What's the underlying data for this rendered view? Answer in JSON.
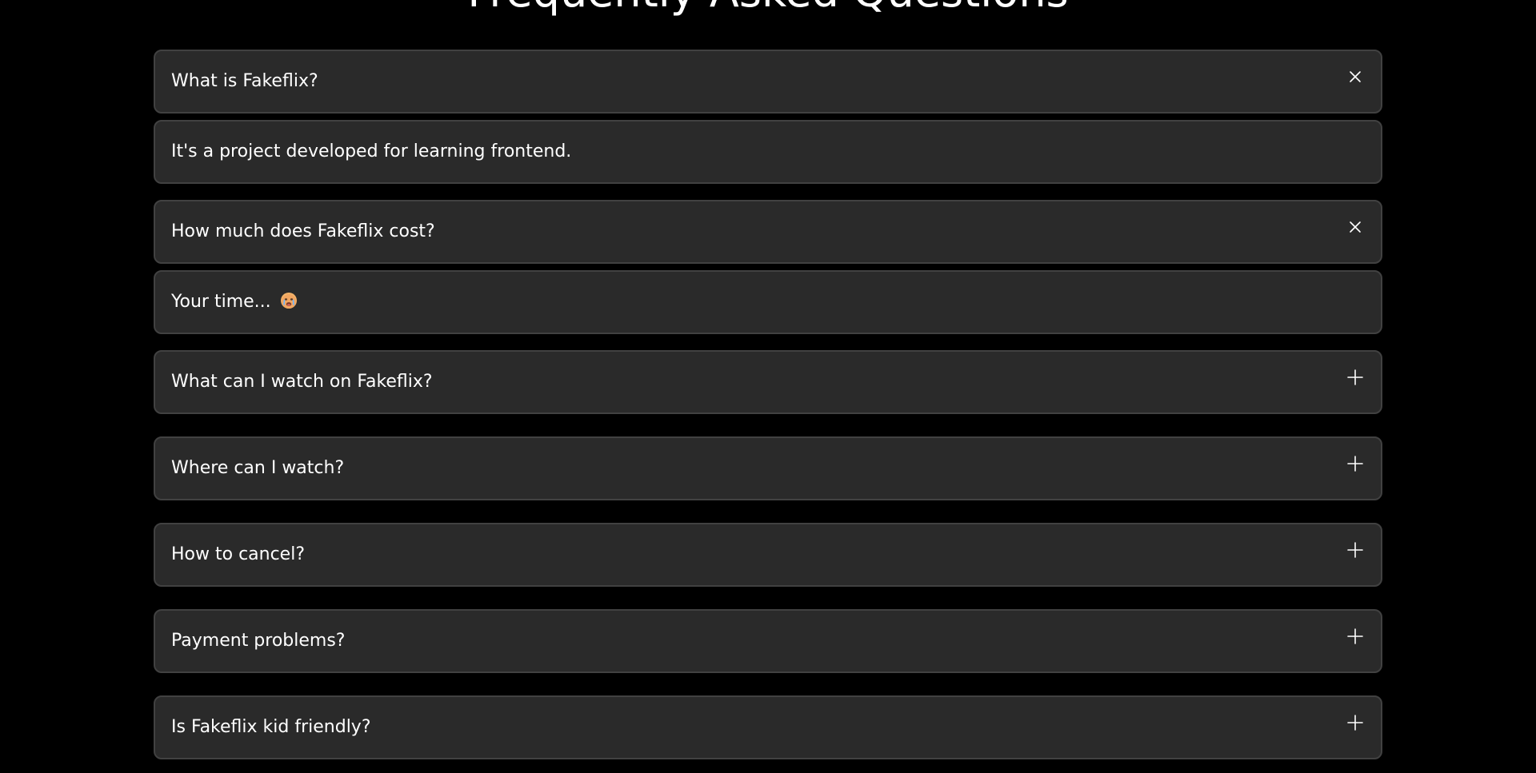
{
  "faq": {
    "title": "Frequently Asked Questions",
    "items": [
      {
        "question": "What is Fakeflix?",
        "answer": "It's a project developed for learning frontend.",
        "open": true,
        "icon": "close-icon"
      },
      {
        "question": "How much does Fakeflix cost?",
        "answer": "Your time...",
        "answer_emoji": "crying-face-emoji",
        "open": true,
        "icon": "close-icon"
      },
      {
        "question": "What can I watch on Fakeflix?",
        "open": false,
        "icon": "plus-icon"
      },
      {
        "question": "Where can I watch?",
        "open": false,
        "icon": "plus-icon"
      },
      {
        "question": "How to cancel?",
        "open": false,
        "icon": "plus-icon"
      },
      {
        "question": "Payment problems?",
        "open": false,
        "icon": "plus-icon"
      },
      {
        "question": "Is Fakeflix kid friendly?",
        "open": false,
        "icon": "plus-icon"
      }
    ]
  },
  "colors": {
    "background": "#000000",
    "card": "#2a2a2a",
    "card_border": "#414141",
    "text": "#ffffff"
  }
}
